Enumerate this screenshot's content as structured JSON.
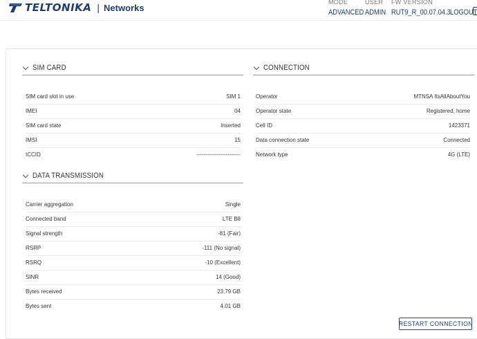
{
  "header": {
    "brand": "TELTONIKA",
    "brand_sub": "Networks",
    "mode_caption": "MODE",
    "mode_value": "ADVANCED",
    "user_caption": "USER",
    "user_value": "ADMIN",
    "fw_caption": "FW VERSION",
    "fw_value": "RUT9_R_00.07.04.3",
    "logout_label": "LOGOUT",
    "brand_color": "#1c3e72"
  },
  "sim_card": {
    "title": "SIM CARD",
    "rows": [
      {
        "key": "SIM card slot in use",
        "value": "SIM 1"
      },
      {
        "key": "IMEI",
        "value": "04"
      },
      {
        "key": "SIM card state",
        "value": "Inserted"
      },
      {
        "key": "IMSI",
        "value": "15"
      },
      {
        "key": "ICCID",
        "value": "------------------------"
      }
    ]
  },
  "connection": {
    "title": "CONNECTION",
    "rows": [
      {
        "key": "Operator",
        "value": "MTNSA ItsAllAboutYou"
      },
      {
        "key": "Operator state",
        "value": "Registered, home"
      },
      {
        "key": "Cell ID",
        "value": "1423371"
      },
      {
        "key": "Data connection state",
        "value": "Connected"
      },
      {
        "key": "Network type",
        "value": "4G (LTE)"
      }
    ]
  },
  "data_transmission": {
    "title": "DATA TRANSMISSION",
    "rows": [
      {
        "key": "Carrier aggregation",
        "value": "Single"
      },
      {
        "key": "Connected band",
        "value": "LTE B8"
      },
      {
        "key": "Signal strength",
        "value": "-81 (Fair)"
      },
      {
        "key": "RSRP",
        "value": "-111 (No signal)"
      },
      {
        "key": "RSRQ",
        "value": "-10 (Excellent)"
      },
      {
        "key": "SINR",
        "value": "14 (Good)"
      },
      {
        "key": "Bytes received",
        "value": "23.79 GB"
      },
      {
        "key": "Bytes sent",
        "value": "4.01 GB"
      }
    ]
  },
  "actions": {
    "restart_label": "RESTART CONNECTION"
  }
}
